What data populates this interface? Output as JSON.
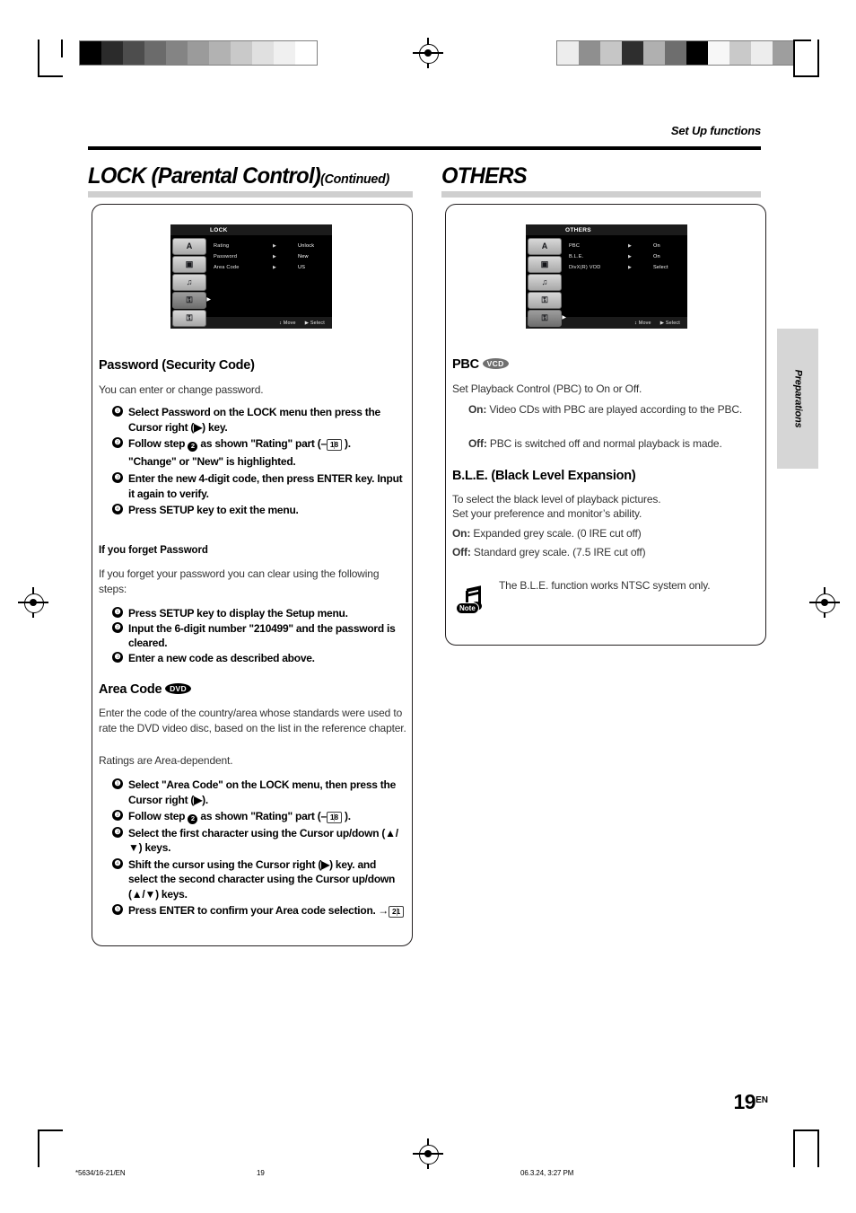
{
  "header": {
    "running_head": "Set Up functions"
  },
  "side_tab": {
    "label": "Preparations"
  },
  "sections": {
    "left": {
      "title": "LOCK (Parental Control)",
      "title_suffix": "(Continued)"
    },
    "right": {
      "title": "OTHERS"
    }
  },
  "osd_lock": {
    "title": "LOCK",
    "icons": [
      {
        "name": "language-icon",
        "glyph": "A",
        "selected": false
      },
      {
        "name": "display-icon",
        "glyph": "▣",
        "selected": false
      },
      {
        "name": "audio-icon",
        "glyph": "♫",
        "selected": false
      },
      {
        "name": "lock-icon",
        "glyph": "⚿",
        "selected": true
      },
      {
        "name": "others-icon",
        "glyph": "⚿",
        "selected": false
      }
    ],
    "rows": [
      {
        "label": "Rating",
        "arrow": "▶",
        "value": "Unlock"
      },
      {
        "label": "Password",
        "arrow": "▶",
        "value": "New"
      },
      {
        "label": "Area Code",
        "arrow": "▶",
        "value": "US"
      }
    ],
    "footer": {
      "move": "Move",
      "select": "Select",
      "move_icon": "↕",
      "select_icon": "▶"
    }
  },
  "osd_others": {
    "title": "OTHERS",
    "icons": [
      {
        "name": "language-icon",
        "glyph": "A",
        "selected": false
      },
      {
        "name": "display-icon",
        "glyph": "▣",
        "selected": false
      },
      {
        "name": "audio-icon",
        "glyph": "♫",
        "selected": false
      },
      {
        "name": "lock-icon",
        "glyph": "⚿",
        "selected": false
      },
      {
        "name": "others-icon",
        "glyph": "⚿",
        "selected": true
      }
    ],
    "rows": [
      {
        "label": "PBC",
        "arrow": "▶",
        "value": "On"
      },
      {
        "label": "B.L.E.",
        "arrow": "▶",
        "value": "On"
      },
      {
        "label": "DivX(R) VOD",
        "arrow": "▶",
        "value": "Select"
      }
    ],
    "footer": {
      "move": "Move",
      "select": "Select",
      "move_icon": "↕",
      "select_icon": "▶"
    }
  },
  "password": {
    "heading": "Password (Security Code)",
    "intro": "You can enter or change password.",
    "steps": [
      {
        "num": "❶",
        "text": "Select Password on the LOCK menu then press the Cursor right (▶) key."
      },
      {
        "num": "❷",
        "text_a": "Follow step ",
        "inline_num": "2",
        "text_b": " as shown \"Rating\" part (–",
        "ref": "18",
        "text_c": " ).",
        "text_d": "\"Change\" or \"New\" is highlighted."
      },
      {
        "num": "❸",
        "text": "Enter the new 4-digit code, then press ENTER key. Input it again to verify."
      },
      {
        "num": "❹",
        "text": "Press SETUP key to exit the menu."
      }
    ]
  },
  "forgot": {
    "heading": "If you forget Password",
    "intro": "If you forget your password you can clear using the following steps:",
    "steps": [
      {
        "num": "❶",
        "text": "Press SETUP key to display the Setup menu."
      },
      {
        "num": "❷",
        "text": "Input the 6-digit number \"210499\" and the password is cleared."
      },
      {
        "num": "❸",
        "text": "Enter a new code as described above."
      }
    ]
  },
  "area_code": {
    "heading": "Area Code",
    "badge": "DVD",
    "intro_1": "Enter the code of the country/area whose standards were used to rate the DVD video disc, based on the list in the reference chapter.",
    "intro_2": "Ratings are Area-dependent.",
    "steps": [
      {
        "num": "❶",
        "text": "Select \"Area Code\" on the LOCK menu, then press the Cursor right (▶)."
      },
      {
        "num": "❷",
        "text_a": "Follow step ",
        "inline_num": "2",
        "text_b": " as shown \"Rating\" part (–",
        "ref": "18",
        "text_c": " )."
      },
      {
        "num": "❸",
        "text": "Select the first character using the Cursor up/down (▲/▼) keys."
      },
      {
        "num": "❹",
        "text": "Shift the cursor using the Cursor right (▶) key. and select the second character using the Cursor up/down (▲/▼) keys."
      },
      {
        "num": "❺",
        "text": "Press ENTER to confirm your Area code selection.",
        "ref": "21",
        "ref_arrow": "→"
      }
    ]
  },
  "pbc": {
    "heading": "PBC",
    "badge": "VCD",
    "intro": "Set Playback Control (PBC) to On or Off.",
    "options": [
      {
        "label": "On:",
        "text": "Video CDs with PBC are played according to the PBC."
      },
      {
        "label": "Off:",
        "text": "PBC is switched off and normal playback is made."
      }
    ]
  },
  "ble": {
    "heading": "B.L.E. (Black Level Expansion)",
    "intro_1": "To select the black level of playback pictures.",
    "intro_2": "Set your preference and monitor’s ability.",
    "options": [
      {
        "label": "On:",
        "text": "Expanded grey scale. (0 IRE cut off)"
      },
      {
        "label": "Off:",
        "text": "Standard grey scale. (7.5 IRE cut off)"
      }
    ],
    "note": {
      "icon_label": "Note",
      "text": "The B.L.E. function works NTSC system only."
    }
  },
  "folio": {
    "number": "19",
    "lang": "EN"
  },
  "slug": {
    "file": "*5634/16-21/EN",
    "page": "19",
    "timestamp": "06.3.24, 3:27 PM"
  },
  "swatches": {
    "left": [
      "#000000",
      "#2b2b2b",
      "#4d4d4d",
      "#6b6b6b",
      "#848484",
      "#9b9b9b",
      "#b2b2b2",
      "#c9c9c9",
      "#e0e0e0",
      "#f0f0f0",
      "#ffffff"
    ],
    "right": [
      "#ededed",
      "#8f8f8f",
      "#c6c6c6",
      "#2e2e2e",
      "#b0b0b0",
      "#6e6e6e",
      "#000000",
      "#f7f7f7",
      "#c9c9c9",
      "#ededed",
      "#9e9e9e"
    ]
  }
}
